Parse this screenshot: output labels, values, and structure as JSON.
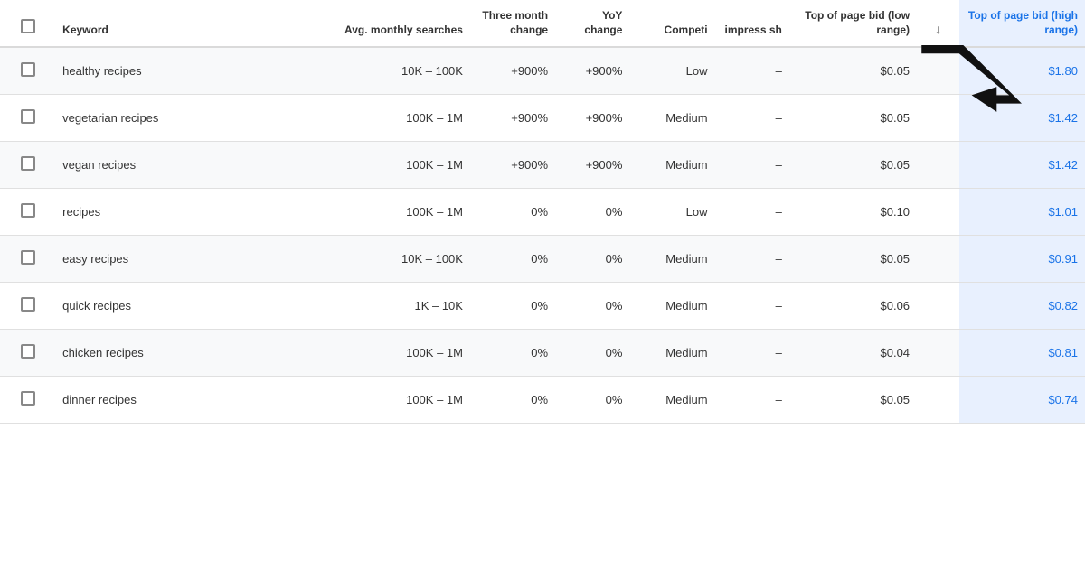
{
  "columns": [
    {
      "key": "check",
      "label": "",
      "class": "col-check"
    },
    {
      "key": "keyword",
      "label": "Keyword",
      "class": "col-keyword"
    },
    {
      "key": "avg",
      "label": "Avg. monthly searches",
      "class": "col-avg"
    },
    {
      "key": "three",
      "label": "Three month change",
      "class": "col-three"
    },
    {
      "key": "yoy",
      "label": "YoY change",
      "class": "col-yoy"
    },
    {
      "key": "comp",
      "label": "Competi",
      "class": "col-comp"
    },
    {
      "key": "impr",
      "label": "impress sh",
      "class": "col-impr"
    },
    {
      "key": "toplow",
      "label": "Top of page bid (low range)",
      "class": "col-toplow"
    },
    {
      "key": "sort",
      "label": "↓",
      "class": "col-sort"
    },
    {
      "key": "tophigh",
      "label": "Top of page bid (high range)",
      "class": "col-tophigh"
    }
  ],
  "rows": [
    {
      "keyword": "healthy recipes",
      "avg": "10K – 100K",
      "three": "+900%",
      "yoy": "+900%",
      "comp": "Low",
      "impr": "–",
      "toplow": "$0.05",
      "tophigh": "$1.80"
    },
    {
      "keyword": "vegetarian recipes",
      "avg": "100K – 1M",
      "three": "+900%",
      "yoy": "+900%",
      "comp": "Medium",
      "impr": "–",
      "toplow": "$0.05",
      "tophigh": "$1.42"
    },
    {
      "keyword": "vegan recipes",
      "avg": "100K – 1M",
      "three": "+900%",
      "yoy": "+900%",
      "comp": "Medium",
      "impr": "–",
      "toplow": "$0.05",
      "tophigh": "$1.42"
    },
    {
      "keyword": "recipes",
      "avg": "100K – 1M",
      "three": "0%",
      "yoy": "0%",
      "comp": "Low",
      "impr": "–",
      "toplow": "$0.10",
      "tophigh": "$1.01"
    },
    {
      "keyword": "easy recipes",
      "avg": "10K – 100K",
      "three": "0%",
      "yoy": "0%",
      "comp": "Medium",
      "impr": "–",
      "toplow": "$0.05",
      "tophigh": "$0.91"
    },
    {
      "keyword": "quick recipes",
      "avg": "1K – 10K",
      "three": "0%",
      "yoy": "0%",
      "comp": "Medium",
      "impr": "–",
      "toplow": "$0.06",
      "tophigh": "$0.82"
    },
    {
      "keyword": "chicken recipes",
      "avg": "100K – 1M",
      "three": "0%",
      "yoy": "0%",
      "comp": "Medium",
      "impr": "–",
      "toplow": "$0.04",
      "tophigh": "$0.81"
    },
    {
      "keyword": "dinner recipes",
      "avg": "100K – 1M",
      "three": "0%",
      "yoy": "0%",
      "comp": "Medium",
      "impr": "–",
      "toplow": "$0.05",
      "tophigh": "$0.74"
    }
  ],
  "arrow": {
    "label": "arrow pointing to top of page bid high range column"
  }
}
